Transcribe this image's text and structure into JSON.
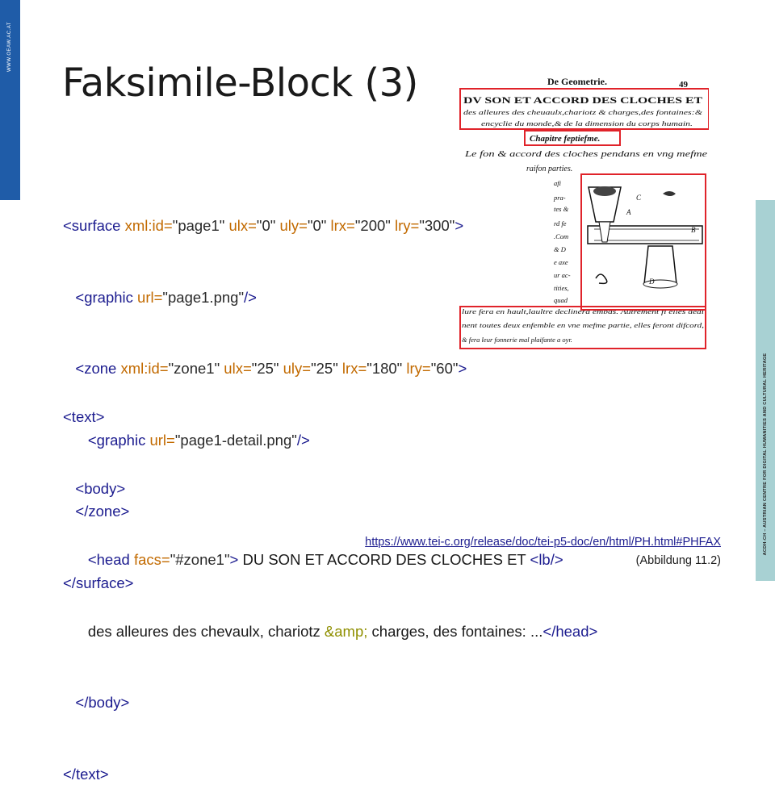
{
  "sidebar_left": {
    "label": "WWW.OEAW.AC.AT",
    "color": "#1f5ca8"
  },
  "sidebar_right": {
    "label": "ACDH-CH – AUSTRIAN CENTRE FOR DIGITAL HUMANITIES AND CULTURAL HERITAGE",
    "color": "#a8d1d3"
  },
  "title": "Faksimile-Block (3)",
  "code_surface": {
    "l1": {
      "open": "<surface ",
      "a1": "xml:id=",
      "v1": "\"page1\" ",
      "a2": "ulx=",
      "v2": "\"0\" ",
      "a3": "uly=",
      "v3": "\"0\" ",
      "a4": "lrx=",
      "v4": "\"200\" ",
      "a5": "lry=",
      "v5": "\"300\"",
      "close": ">"
    },
    "l2": {
      "open": "<graphic ",
      "a1": "url=",
      "v1": "\"page1.png\"",
      "close": "/>"
    },
    "l3": {
      "open": "<zone ",
      "a1": "xml:id=",
      "v1": "\"zone1\" ",
      "a2": "ulx=",
      "v2": "\"25\" ",
      "a3": "uly=",
      "v3": "\"25\" ",
      "a4": "lrx=",
      "v4": "\"180\" ",
      "a5": "lry=",
      "v5": "\"60\"",
      "close": ">"
    },
    "l4": {
      "open": "<graphic ",
      "a1": "url=",
      "v1": "\"page1-detail.png\"",
      "close": "/>"
    },
    "l5": "</zone>",
    "l6": "</surface>"
  },
  "code_text": {
    "l1": "<text>",
    "l2": "<body>",
    "l3": {
      "open": "<head ",
      "a1": "facs=",
      "v1": "\"#zone1\"",
      "close": ">",
      "text": " DU SON ET ACCORD DES CLOCHES ET ",
      "lb": "<lb/>"
    },
    "l4": {
      "text1": "des alleures des chevaulx, chariotz ",
      "ent": "&amp;",
      "text2": " charges, des fontaines: ...",
      "close": "</head>"
    },
    "l5": "</body>",
    "l6": "</text>"
  },
  "facsimile": {
    "header": "De Geometrie.",
    "page_number": "49",
    "heading_line1": "DV SON ET ACCORD DES CLOCHES ET",
    "heading_line2": "des alleures des cheuaulx,chariotz & charges,des fontaines:&",
    "heading_line3": "encyclie du monde,& de la dimension du corps humain.",
    "chapter": "Chapitre feptiefme.",
    "para_line1": "Le fon & accord des cloches pendans en vng mefme",
    "para_line2": "raifon parties.",
    "margin_lines": [
      "afi",
      "pra-",
      "tes &",
      "rd fe",
      ".Com",
      "& D",
      "e axe",
      "ur ac-",
      "tities,",
      "quad"
    ],
    "figure_labels": [
      "A",
      "B",
      "C",
      "D"
    ],
    "bottom_line1": "lure fera en hault,laultre declinera embas. Autrement fi elles dedi",
    "bottom_line2": "nent toutes deux enfemble en vne mefme partie, elles feront difcord,",
    "bottom_line3": "& fera leur fonnerie mal plaifante a oyr."
  },
  "link": "https://www.tei-c.org/release/doc/tei-p5-doc/en/html/PH.html#PHFAX",
  "caption": "(Abbildung 11.2)"
}
